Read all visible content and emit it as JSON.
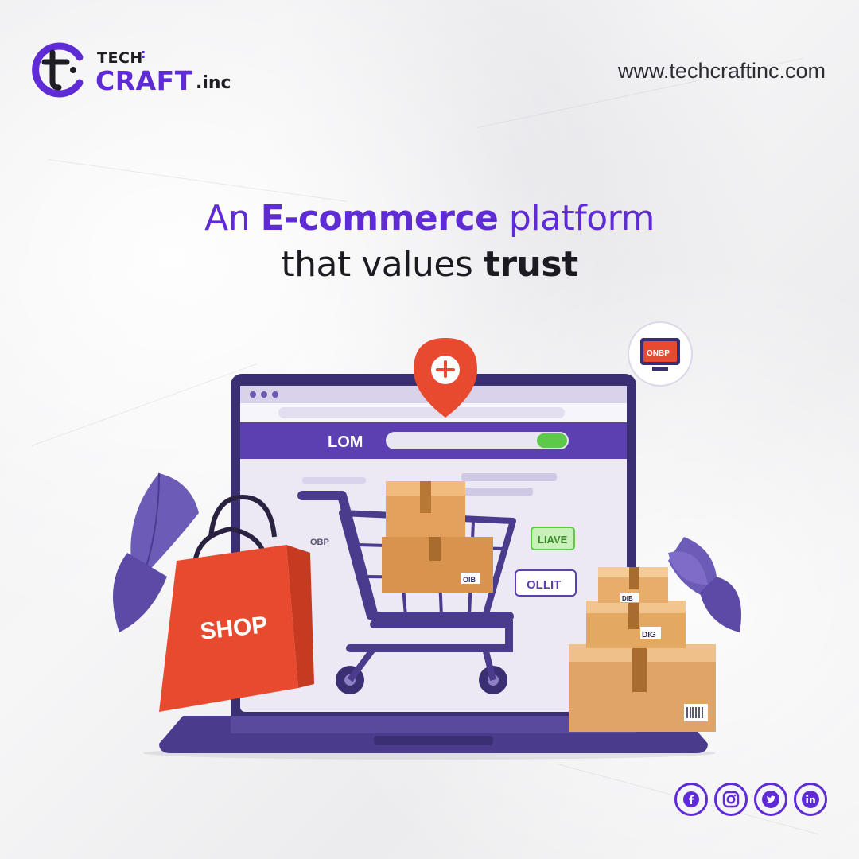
{
  "brand": {
    "logo_tech": "TECH",
    "logo_craft": "CRAFT",
    "logo_inc": ".inc",
    "website": "www.techcraftinc.com",
    "accent_color": "#5e2bd4"
  },
  "headline": {
    "line1_prefix": "An ",
    "line1_bold": "E-commerce",
    "line1_suffix": " platform",
    "line2_prefix": "that values ",
    "line2_bold": "trust"
  },
  "illustration": {
    "screen_site_text": "LOM",
    "screen_button_green": "LIAVE",
    "screen_button_purple": "OLLIT",
    "screen_small_text": "OBP",
    "monitor_badge_text": "ONBP",
    "bag_label": "SHOP",
    "box_label_1": "DIB",
    "box_label_2": "DIG",
    "box_label_3": "OIB"
  },
  "socials": [
    {
      "icon": "facebook-icon",
      "label": "f"
    },
    {
      "icon": "instagram-icon",
      "label": ""
    },
    {
      "icon": "twitter-icon",
      "label": ""
    },
    {
      "icon": "linkedin-icon",
      "label": "in"
    }
  ]
}
